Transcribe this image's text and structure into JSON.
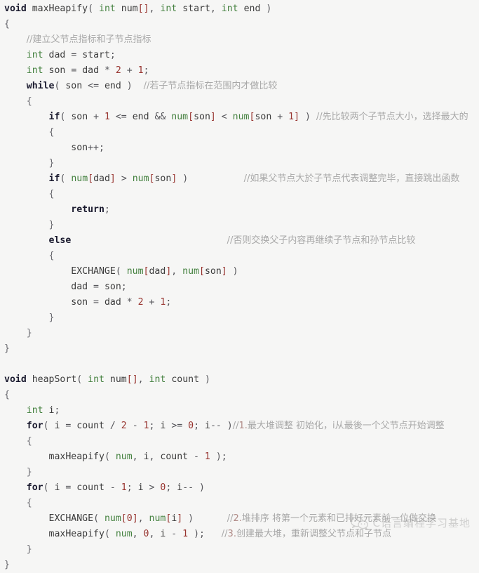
{
  "document": {
    "kind": "source-code-listing",
    "language": "C",
    "background_color": "#f6f6f5"
  },
  "theme": {
    "keyword_color": "#1a1a2e",
    "type_color": "#44813f",
    "identifier_color": "#3c3c3c",
    "number_color": "#97332e",
    "bracket_color": "#97332e",
    "punctuation_color": "#55555a",
    "comment_color": "#a8a8a8"
  },
  "watermark": {
    "icon": "wechat-icon",
    "text": "C语言编程学习基地"
  },
  "code": {
    "lines": [
      {
        "n": 1,
        "indent": 0,
        "tokens": [
          {
            "t": "void",
            "c": "kw"
          },
          {
            "t": " ",
            "c": "ws"
          },
          {
            "t": "maxHeapify",
            "c": "fn"
          },
          {
            "t": "( ",
            "c": "punct"
          },
          {
            "t": "int",
            "c": "type"
          },
          {
            "t": " ",
            "c": "ws"
          },
          {
            "t": "num",
            "c": "id"
          },
          {
            "t": "[]",
            "c": "brk"
          },
          {
            "t": ", ",
            "c": "punct"
          },
          {
            "t": "int",
            "c": "type"
          },
          {
            "t": " ",
            "c": "ws"
          },
          {
            "t": "start",
            "c": "id"
          },
          {
            "t": ", ",
            "c": "punct"
          },
          {
            "t": "int",
            "c": "type"
          },
          {
            "t": " ",
            "c": "ws"
          },
          {
            "t": "end",
            "c": "id"
          },
          {
            "t": " )",
            "c": "punct"
          }
        ]
      },
      {
        "n": 2,
        "indent": 0,
        "tokens": [
          {
            "t": "{",
            "c": "brace"
          }
        ]
      },
      {
        "n": 3,
        "indent": 1,
        "tokens": [
          {
            "t": "//建立父节点指标和子节点指标",
            "c": "cmt"
          }
        ]
      },
      {
        "n": 4,
        "indent": 1,
        "tokens": [
          {
            "t": "int",
            "c": "type"
          },
          {
            "t": " ",
            "c": "ws"
          },
          {
            "t": "dad",
            "c": "id"
          },
          {
            "t": " = ",
            "c": "punct"
          },
          {
            "t": "start",
            "c": "id"
          },
          {
            "t": ";",
            "c": "punct"
          }
        ]
      },
      {
        "n": 5,
        "indent": 1,
        "tokens": [
          {
            "t": "int",
            "c": "type"
          },
          {
            "t": " ",
            "c": "ws"
          },
          {
            "t": "son",
            "c": "id"
          },
          {
            "t": " = ",
            "c": "punct"
          },
          {
            "t": "dad",
            "c": "id"
          },
          {
            "t": " * ",
            "c": "punct"
          },
          {
            "t": "2",
            "c": "num"
          },
          {
            "t": " + ",
            "c": "punct"
          },
          {
            "t": "1",
            "c": "num"
          },
          {
            "t": ";",
            "c": "punct"
          }
        ]
      },
      {
        "n": 6,
        "indent": 1,
        "tokens": [
          {
            "t": "while",
            "c": "kw"
          },
          {
            "t": "( ",
            "c": "punct"
          },
          {
            "t": "son",
            "c": "id"
          },
          {
            "t": " <= ",
            "c": "punct"
          },
          {
            "t": "end",
            "c": "id"
          },
          {
            "t": " )",
            "c": "punct"
          },
          {
            "t": "  ",
            "c": "ws"
          },
          {
            "t": "//若子节点指标在范围内才做比较",
            "c": "cmt"
          }
        ]
      },
      {
        "n": 7,
        "indent": 1,
        "tokens": [
          {
            "t": "{",
            "c": "brace"
          }
        ]
      },
      {
        "n": 8,
        "indent": 2,
        "tokens": [
          {
            "t": "if",
            "c": "kw"
          },
          {
            "t": "( ",
            "c": "punct"
          },
          {
            "t": "son",
            "c": "id"
          },
          {
            "t": " + ",
            "c": "punct"
          },
          {
            "t": "1",
            "c": "num"
          },
          {
            "t": " <= ",
            "c": "punct"
          },
          {
            "t": "end",
            "c": "id"
          },
          {
            "t": " && ",
            "c": "punct"
          },
          {
            "t": "num",
            "c": "var"
          },
          {
            "t": "[",
            "c": "brk"
          },
          {
            "t": "son",
            "c": "id"
          },
          {
            "t": "]",
            "c": "brk"
          },
          {
            "t": " < ",
            "c": "punct"
          },
          {
            "t": "num",
            "c": "var"
          },
          {
            "t": "[",
            "c": "brk"
          },
          {
            "t": "son",
            "c": "id"
          },
          {
            "t": " + ",
            "c": "punct"
          },
          {
            "t": "1",
            "c": "num"
          },
          {
            "t": "]",
            "c": "brk"
          },
          {
            "t": " ) ",
            "c": "punct"
          },
          {
            "t": "//先比较两个子节点大小，选择最大的",
            "c": "cmt"
          }
        ]
      },
      {
        "n": 9,
        "indent": 2,
        "tokens": [
          {
            "t": "{",
            "c": "brace"
          }
        ]
      },
      {
        "n": 10,
        "indent": 3,
        "tokens": [
          {
            "t": "son",
            "c": "id"
          },
          {
            "t": "++;",
            "c": "punct"
          }
        ]
      },
      {
        "n": 11,
        "indent": 2,
        "tokens": [
          {
            "t": "}",
            "c": "brace"
          }
        ]
      },
      {
        "n": 12,
        "indent": 2,
        "tokens": [
          {
            "t": "if",
            "c": "kw"
          },
          {
            "t": "( ",
            "c": "punct"
          },
          {
            "t": "num",
            "c": "var"
          },
          {
            "t": "[",
            "c": "brk"
          },
          {
            "t": "dad",
            "c": "id"
          },
          {
            "t": "]",
            "c": "brk"
          },
          {
            "t": " > ",
            "c": "punct"
          },
          {
            "t": "num",
            "c": "var"
          },
          {
            "t": "[",
            "c": "brk"
          },
          {
            "t": "son",
            "c": "id"
          },
          {
            "t": "]",
            "c": "brk"
          },
          {
            "t": " )",
            "c": "punct"
          },
          {
            "t": "          ",
            "c": "ws"
          },
          {
            "t": "//如果父节点大於子节点代表调整完毕，直接跳出函数",
            "c": "cmt"
          }
        ]
      },
      {
        "n": 13,
        "indent": 2,
        "tokens": [
          {
            "t": "{",
            "c": "brace"
          }
        ]
      },
      {
        "n": 14,
        "indent": 3,
        "tokens": [
          {
            "t": "return",
            "c": "kw"
          },
          {
            "t": ";",
            "c": "punct"
          }
        ]
      },
      {
        "n": 15,
        "indent": 2,
        "tokens": [
          {
            "t": "}",
            "c": "brace"
          }
        ]
      },
      {
        "n": 16,
        "indent": 2,
        "tokens": [
          {
            "t": "else",
            "c": "kw"
          },
          {
            "t": "                            ",
            "c": "ws"
          },
          {
            "t": "//否则交换父子内容再继续子节点和孙节点比较",
            "c": "cmt"
          }
        ]
      },
      {
        "n": 17,
        "indent": 2,
        "tokens": [
          {
            "t": "{",
            "c": "brace"
          }
        ]
      },
      {
        "n": 18,
        "indent": 3,
        "tokens": [
          {
            "t": "EXCHANGE",
            "c": "fn"
          },
          {
            "t": "( ",
            "c": "punct"
          },
          {
            "t": "num",
            "c": "var"
          },
          {
            "t": "[",
            "c": "brk"
          },
          {
            "t": "dad",
            "c": "id"
          },
          {
            "t": "]",
            "c": "brk"
          },
          {
            "t": ", ",
            "c": "punct"
          },
          {
            "t": "num",
            "c": "var"
          },
          {
            "t": "[",
            "c": "brk"
          },
          {
            "t": "son",
            "c": "id"
          },
          {
            "t": "]",
            "c": "brk"
          },
          {
            "t": " )",
            "c": "punct"
          }
        ]
      },
      {
        "n": 19,
        "indent": 3,
        "tokens": [
          {
            "t": "dad",
            "c": "id"
          },
          {
            "t": " = ",
            "c": "punct"
          },
          {
            "t": "son",
            "c": "id"
          },
          {
            "t": ";",
            "c": "punct"
          }
        ]
      },
      {
        "n": 20,
        "indent": 3,
        "tokens": [
          {
            "t": "son",
            "c": "id"
          },
          {
            "t": " = ",
            "c": "punct"
          },
          {
            "t": "dad",
            "c": "id"
          },
          {
            "t": " * ",
            "c": "punct"
          },
          {
            "t": "2",
            "c": "num"
          },
          {
            "t": " + ",
            "c": "punct"
          },
          {
            "t": "1",
            "c": "num"
          },
          {
            "t": ";",
            "c": "punct"
          }
        ]
      },
      {
        "n": 21,
        "indent": 2,
        "tokens": [
          {
            "t": "}",
            "c": "brace"
          }
        ]
      },
      {
        "n": 22,
        "indent": 1,
        "tokens": [
          {
            "t": "}",
            "c": "brace"
          }
        ]
      },
      {
        "n": 23,
        "indent": 0,
        "tokens": [
          {
            "t": "}",
            "c": "brace"
          }
        ]
      },
      {
        "n": 24,
        "indent": 0,
        "tokens": []
      },
      {
        "n": 25,
        "indent": 0,
        "tokens": [
          {
            "t": "void",
            "c": "kw"
          },
          {
            "t": " ",
            "c": "ws"
          },
          {
            "t": "heapSort",
            "c": "fn"
          },
          {
            "t": "( ",
            "c": "punct"
          },
          {
            "t": "int",
            "c": "type"
          },
          {
            "t": " ",
            "c": "ws"
          },
          {
            "t": "num",
            "c": "id"
          },
          {
            "t": "[]",
            "c": "brk"
          },
          {
            "t": ", ",
            "c": "punct"
          },
          {
            "t": "int",
            "c": "type"
          },
          {
            "t": " ",
            "c": "ws"
          },
          {
            "t": "count",
            "c": "id"
          },
          {
            "t": " )",
            "c": "punct"
          }
        ]
      },
      {
        "n": 26,
        "indent": 0,
        "tokens": [
          {
            "t": "{",
            "c": "brace"
          }
        ]
      },
      {
        "n": 27,
        "indent": 1,
        "tokens": [
          {
            "t": "int",
            "c": "type"
          },
          {
            "t": " ",
            "c": "ws"
          },
          {
            "t": "i",
            "c": "id"
          },
          {
            "t": ";",
            "c": "punct"
          }
        ]
      },
      {
        "n": 28,
        "indent": 1,
        "tokens": [
          {
            "t": "for",
            "c": "kw"
          },
          {
            "t": "( ",
            "c": "punct"
          },
          {
            "t": "i",
            "c": "id"
          },
          {
            "t": " = ",
            "c": "punct"
          },
          {
            "t": "count",
            "c": "id"
          },
          {
            "t": " / ",
            "c": "punct"
          },
          {
            "t": "2",
            "c": "num"
          },
          {
            "t": " - ",
            "c": "punct"
          },
          {
            "t": "1",
            "c": "num"
          },
          {
            "t": "; ",
            "c": "punct"
          },
          {
            "t": "i",
            "c": "id"
          },
          {
            "t": " >= ",
            "c": "punct"
          },
          {
            "t": "0",
            "c": "num"
          },
          {
            "t": "; ",
            "c": "punct"
          },
          {
            "t": "i",
            "c": "id"
          },
          {
            "t": "-- )",
            "c": "punct"
          },
          {
            "t": "//",
            "c": "cmt"
          },
          {
            "t": "1.",
            "c": "cmtnum"
          },
          {
            "t": "最大堆调整 初始化，i从最後一个父节点开始调整",
            "c": "cmt"
          }
        ]
      },
      {
        "n": 29,
        "indent": 1,
        "tokens": [
          {
            "t": "{",
            "c": "brace"
          }
        ]
      },
      {
        "n": 30,
        "indent": 2,
        "tokens": [
          {
            "t": "maxHeapify",
            "c": "fn"
          },
          {
            "t": "( ",
            "c": "punct"
          },
          {
            "t": "num",
            "c": "var"
          },
          {
            "t": ", ",
            "c": "punct"
          },
          {
            "t": "i",
            "c": "id"
          },
          {
            "t": ", ",
            "c": "punct"
          },
          {
            "t": "count",
            "c": "id"
          },
          {
            "t": " - ",
            "c": "punct"
          },
          {
            "t": "1",
            "c": "num"
          },
          {
            "t": " );",
            "c": "punct"
          }
        ]
      },
      {
        "n": 31,
        "indent": 1,
        "tokens": [
          {
            "t": "}",
            "c": "brace"
          }
        ]
      },
      {
        "n": 32,
        "indent": 1,
        "tokens": [
          {
            "t": "for",
            "c": "kw"
          },
          {
            "t": "( ",
            "c": "punct"
          },
          {
            "t": "i",
            "c": "id"
          },
          {
            "t": " = ",
            "c": "punct"
          },
          {
            "t": "count",
            "c": "id"
          },
          {
            "t": " - ",
            "c": "punct"
          },
          {
            "t": "1",
            "c": "num"
          },
          {
            "t": "; ",
            "c": "punct"
          },
          {
            "t": "i",
            "c": "id"
          },
          {
            "t": " > ",
            "c": "punct"
          },
          {
            "t": "0",
            "c": "num"
          },
          {
            "t": "; ",
            "c": "punct"
          },
          {
            "t": "i",
            "c": "id"
          },
          {
            "t": "-- )",
            "c": "punct"
          }
        ]
      },
      {
        "n": 33,
        "indent": 1,
        "tokens": [
          {
            "t": "{",
            "c": "brace"
          }
        ]
      },
      {
        "n": 34,
        "indent": 2,
        "tokens": [
          {
            "t": "EXCHANGE",
            "c": "fn"
          },
          {
            "t": "( ",
            "c": "punct"
          },
          {
            "t": "num",
            "c": "var"
          },
          {
            "t": "[",
            "c": "brk"
          },
          {
            "t": "0",
            "c": "num"
          },
          {
            "t": "]",
            "c": "brk"
          },
          {
            "t": ", ",
            "c": "punct"
          },
          {
            "t": "num",
            "c": "var"
          },
          {
            "t": "[",
            "c": "brk"
          },
          {
            "t": "i",
            "c": "id"
          },
          {
            "t": "]",
            "c": "brk"
          },
          {
            "t": " )",
            "c": "punct"
          },
          {
            "t": "      ",
            "c": "ws"
          },
          {
            "t": "//",
            "c": "cmt"
          },
          {
            "t": "2.",
            "c": "cmtnum"
          },
          {
            "t": "堆排序 将第一个元素和已排好元素前一位做交换",
            "c": "cmt"
          }
        ]
      },
      {
        "n": 35,
        "indent": 2,
        "tokens": [
          {
            "t": "maxHeapify",
            "c": "fn"
          },
          {
            "t": "( ",
            "c": "punct"
          },
          {
            "t": "num",
            "c": "var"
          },
          {
            "t": ", ",
            "c": "punct"
          },
          {
            "t": "0",
            "c": "num"
          },
          {
            "t": ", ",
            "c": "punct"
          },
          {
            "t": "i",
            "c": "id"
          },
          {
            "t": " - ",
            "c": "punct"
          },
          {
            "t": "1",
            "c": "num"
          },
          {
            "t": " );",
            "c": "punct"
          },
          {
            "t": "   ",
            "c": "ws"
          },
          {
            "t": "//",
            "c": "cmt"
          },
          {
            "t": "3.",
            "c": "cmtnum"
          },
          {
            "t": "创建最大堆，重新调整父节点和子节点",
            "c": "cmt"
          }
        ]
      },
      {
        "n": 36,
        "indent": 1,
        "tokens": [
          {
            "t": "}",
            "c": "brace"
          }
        ]
      },
      {
        "n": 37,
        "indent": 0,
        "tokens": [
          {
            "t": "}",
            "c": "brace"
          }
        ]
      }
    ]
  }
}
